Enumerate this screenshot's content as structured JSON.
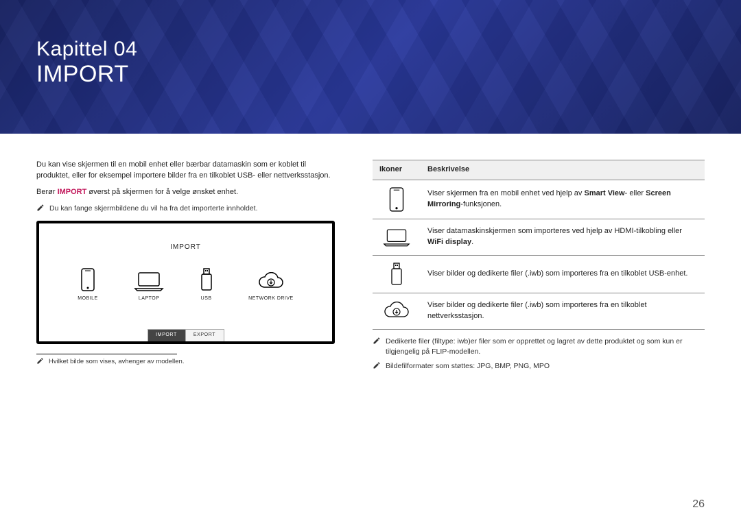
{
  "header": {
    "chapter": "Kapittel 04",
    "name": "IMPORT"
  },
  "left": {
    "intro": "Du kan vise skjermen til en mobil enhet eller bærbar datamaskin som er koblet til produktet, eller for eksempel importere bilder fra en tilkoblet USB- eller nettverksstasjon.",
    "instruction_pre": "Berør ",
    "instruction_bold": "IMPORT",
    "instruction_post": " øverst på skjermen for å velge ønsket enhet.",
    "note1": "Du kan fange skjermbildene du vil ha fra det importerte innholdet.",
    "figure": {
      "title": "IMPORT",
      "items": [
        {
          "label": "MOBILE",
          "icon": "mobile-icon"
        },
        {
          "label": "LAPTOP",
          "icon": "laptop-icon"
        },
        {
          "label": "USB",
          "icon": "usb-icon"
        },
        {
          "label": "NETWORK DRIVE",
          "icon": "cloud-download-icon"
        }
      ],
      "tab_import": "IMPORT",
      "tab_export": "EXPORT"
    },
    "figcaption": "Hvilket bilde som vises, avhenger av modellen."
  },
  "table": {
    "col_icons": "Ikoner",
    "col_desc": "Beskrivelse",
    "rows": [
      {
        "icon": "mobile-icon",
        "text_pre": "Viser skjermen fra en mobil enhet ved hjelp av ",
        "bold1": "Smart View",
        "mid": "- eller ",
        "bold2": "Screen Mirroring",
        "text_post": "-funksjonen."
      },
      {
        "icon": "laptop-icon",
        "text_pre": "Viser datamaskinskjermen som importeres ved hjelp av HDMI-tilkobling eller ",
        "bold1": "WiFi display",
        "mid": "",
        "bold2": "",
        "text_post": "."
      },
      {
        "icon": "usb-icon",
        "text_pre": "Viser bilder og dedikerte filer (.iwb) som importeres fra en tilkoblet USB-enhet.",
        "bold1": "",
        "mid": "",
        "bold2": "",
        "text_post": ""
      },
      {
        "icon": "cloud-download-icon",
        "text_pre": "Viser bilder og dedikerte filer (.iwb) som importeres fra en tilkoblet nettverksstasjon.",
        "bold1": "",
        "mid": "",
        "bold2": "",
        "text_post": ""
      }
    ]
  },
  "right_notes": [
    "Dedikerte filer (filtype: iwb)er filer som er opprettet og lagret av dette produktet og som kun er tilgjengelig på FLIP-modellen.",
    "Bildefilformater som støttes: JPG, BMP, PNG, MPO"
  ],
  "page_number": "26"
}
